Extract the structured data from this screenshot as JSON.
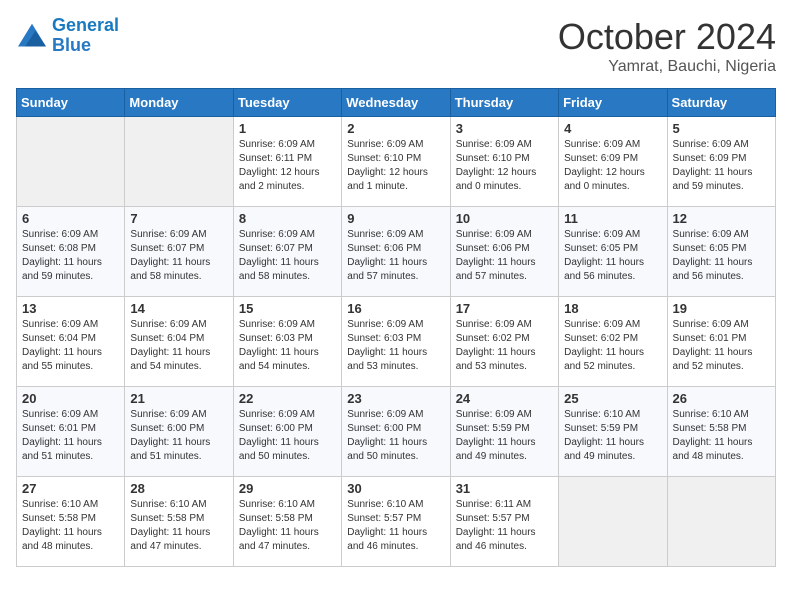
{
  "header": {
    "logo_general": "General",
    "logo_blue": "Blue",
    "month": "October 2024",
    "location": "Yamrat, Bauchi, Nigeria"
  },
  "days_of_week": [
    "Sunday",
    "Monday",
    "Tuesday",
    "Wednesday",
    "Thursday",
    "Friday",
    "Saturday"
  ],
  "weeks": [
    [
      {
        "day": "",
        "info": ""
      },
      {
        "day": "",
        "info": ""
      },
      {
        "day": "1",
        "info": "Sunrise: 6:09 AM\nSunset: 6:11 PM\nDaylight: 12 hours\nand 2 minutes."
      },
      {
        "day": "2",
        "info": "Sunrise: 6:09 AM\nSunset: 6:10 PM\nDaylight: 12 hours\nand 1 minute."
      },
      {
        "day": "3",
        "info": "Sunrise: 6:09 AM\nSunset: 6:10 PM\nDaylight: 12 hours\nand 0 minutes."
      },
      {
        "day": "4",
        "info": "Sunrise: 6:09 AM\nSunset: 6:09 PM\nDaylight: 12 hours\nand 0 minutes."
      },
      {
        "day": "5",
        "info": "Sunrise: 6:09 AM\nSunset: 6:09 PM\nDaylight: 11 hours\nand 59 minutes."
      }
    ],
    [
      {
        "day": "6",
        "info": "Sunrise: 6:09 AM\nSunset: 6:08 PM\nDaylight: 11 hours\nand 59 minutes."
      },
      {
        "day": "7",
        "info": "Sunrise: 6:09 AM\nSunset: 6:07 PM\nDaylight: 11 hours\nand 58 minutes."
      },
      {
        "day": "8",
        "info": "Sunrise: 6:09 AM\nSunset: 6:07 PM\nDaylight: 11 hours\nand 58 minutes."
      },
      {
        "day": "9",
        "info": "Sunrise: 6:09 AM\nSunset: 6:06 PM\nDaylight: 11 hours\nand 57 minutes."
      },
      {
        "day": "10",
        "info": "Sunrise: 6:09 AM\nSunset: 6:06 PM\nDaylight: 11 hours\nand 57 minutes."
      },
      {
        "day": "11",
        "info": "Sunrise: 6:09 AM\nSunset: 6:05 PM\nDaylight: 11 hours\nand 56 minutes."
      },
      {
        "day": "12",
        "info": "Sunrise: 6:09 AM\nSunset: 6:05 PM\nDaylight: 11 hours\nand 56 minutes."
      }
    ],
    [
      {
        "day": "13",
        "info": "Sunrise: 6:09 AM\nSunset: 6:04 PM\nDaylight: 11 hours\nand 55 minutes."
      },
      {
        "day": "14",
        "info": "Sunrise: 6:09 AM\nSunset: 6:04 PM\nDaylight: 11 hours\nand 54 minutes."
      },
      {
        "day": "15",
        "info": "Sunrise: 6:09 AM\nSunset: 6:03 PM\nDaylight: 11 hours\nand 54 minutes."
      },
      {
        "day": "16",
        "info": "Sunrise: 6:09 AM\nSunset: 6:03 PM\nDaylight: 11 hours\nand 53 minutes."
      },
      {
        "day": "17",
        "info": "Sunrise: 6:09 AM\nSunset: 6:02 PM\nDaylight: 11 hours\nand 53 minutes."
      },
      {
        "day": "18",
        "info": "Sunrise: 6:09 AM\nSunset: 6:02 PM\nDaylight: 11 hours\nand 52 minutes."
      },
      {
        "day": "19",
        "info": "Sunrise: 6:09 AM\nSunset: 6:01 PM\nDaylight: 11 hours\nand 52 minutes."
      }
    ],
    [
      {
        "day": "20",
        "info": "Sunrise: 6:09 AM\nSunset: 6:01 PM\nDaylight: 11 hours\nand 51 minutes."
      },
      {
        "day": "21",
        "info": "Sunrise: 6:09 AM\nSunset: 6:00 PM\nDaylight: 11 hours\nand 51 minutes."
      },
      {
        "day": "22",
        "info": "Sunrise: 6:09 AM\nSunset: 6:00 PM\nDaylight: 11 hours\nand 50 minutes."
      },
      {
        "day": "23",
        "info": "Sunrise: 6:09 AM\nSunset: 6:00 PM\nDaylight: 11 hours\nand 50 minutes."
      },
      {
        "day": "24",
        "info": "Sunrise: 6:09 AM\nSunset: 5:59 PM\nDaylight: 11 hours\nand 49 minutes."
      },
      {
        "day": "25",
        "info": "Sunrise: 6:10 AM\nSunset: 5:59 PM\nDaylight: 11 hours\nand 49 minutes."
      },
      {
        "day": "26",
        "info": "Sunrise: 6:10 AM\nSunset: 5:58 PM\nDaylight: 11 hours\nand 48 minutes."
      }
    ],
    [
      {
        "day": "27",
        "info": "Sunrise: 6:10 AM\nSunset: 5:58 PM\nDaylight: 11 hours\nand 48 minutes."
      },
      {
        "day": "28",
        "info": "Sunrise: 6:10 AM\nSunset: 5:58 PM\nDaylight: 11 hours\nand 47 minutes."
      },
      {
        "day": "29",
        "info": "Sunrise: 6:10 AM\nSunset: 5:58 PM\nDaylight: 11 hours\nand 47 minutes."
      },
      {
        "day": "30",
        "info": "Sunrise: 6:10 AM\nSunset: 5:57 PM\nDaylight: 11 hours\nand 46 minutes."
      },
      {
        "day": "31",
        "info": "Sunrise: 6:11 AM\nSunset: 5:57 PM\nDaylight: 11 hours\nand 46 minutes."
      },
      {
        "day": "",
        "info": ""
      },
      {
        "day": "",
        "info": ""
      }
    ]
  ]
}
